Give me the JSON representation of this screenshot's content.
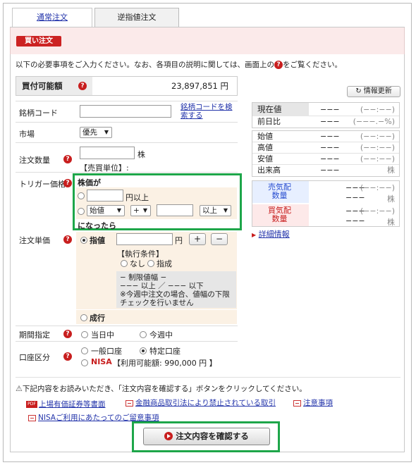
{
  "tabs": [
    {
      "label": "通常注文"
    },
    {
      "label": "逆指値注文"
    }
  ],
  "badge": "買い注文",
  "intro": {
    "before": "以下の必要事項をご入力ください。なお、各項目の説明に関しては、画面上の",
    "after": "をご覧ください。"
  },
  "help_glyph": "?",
  "purchasing_power": {
    "label": "買付可能額",
    "value": "23,897,851 円"
  },
  "fields": {
    "code_label": "銘柄コード",
    "code_search_link": "銘柄コードを検索する",
    "market_label": "市場",
    "market_value": "優先",
    "qty_label": "注文数量",
    "qty_unit": "株",
    "sell_unit": "【売買単位】:",
    "trigger_label": "トリガー価格",
    "trigger_title": "株価が",
    "trigger_price_suffix": "円以上",
    "trigger_ref_select": "始値",
    "trigger_sign_select": "+",
    "trigger_cond_select": "以上",
    "trigger_footer": "になったら",
    "price_label": "注文単価",
    "limit_label": "指値",
    "limit_unit": "円",
    "plus": "+",
    "minus": "−",
    "exec_cond_title": "【執行条件】",
    "exec_none": "なし",
    "exec_limit": "指成",
    "range_title": "− 制限値幅 −",
    "range_line": "−−− 以上 ／ −−− 以下",
    "range_note1": "※今週中注文の場合、値幅の下限",
    "range_note2": "チェックを行いません",
    "market_order": "成行",
    "period_label": "期間指定",
    "period_today": "当日中",
    "period_week": "今週中",
    "account_label": "口座区分",
    "account_general": "一般口座",
    "account_specific": "特定口座",
    "nisa_label": "NISA",
    "nisa_available": "【利用可能額: 990,000 円 】"
  },
  "quote": {
    "refresh_label": "情報更新",
    "current": {
      "label": "現在値",
      "value": "−−−",
      "sub": "(−−:−−)"
    },
    "change": {
      "label": "前日比",
      "value": "−−−",
      "sub": "(−−−.−%)"
    },
    "open": {
      "label": "始値",
      "value": "−−−",
      "sub": "(−−:−−)"
    },
    "high": {
      "label": "高値",
      "value": "−−−",
      "sub": "(−−:−−)"
    },
    "low": {
      "label": "安値",
      "value": "−−−",
      "sub": "(−−:−−)"
    },
    "volume": {
      "label": "出来高",
      "value": "−−−",
      "sub": "株"
    },
    "ask": {
      "label1": "売気配",
      "label2": "数量",
      "value": "−−−",
      "sub": "(−−:−−)",
      "qty_unit": "株",
      "qty_value": "−−−"
    },
    "bid": {
      "label1": "買気配",
      "label2": "数量",
      "value": "−−−",
      "sub": "(−−:−−)",
      "qty_unit": "株",
      "qty_value": "−−−"
    },
    "detail_link": "詳細情報"
  },
  "footer": {
    "note": "下記内容をお読みいただき、「注文内容を確認する」ボタンをクリックしてください。",
    "link_prospectus": "上場有価証券等書面",
    "link_prohibited": "金融商品取引法により禁止されている取引",
    "link_caution": "注意事項",
    "link_nisa": "NISAご利用にあたってのご留意事項",
    "confirm_button": "注文内容を確認する",
    "pdf_text": "PDF"
  }
}
